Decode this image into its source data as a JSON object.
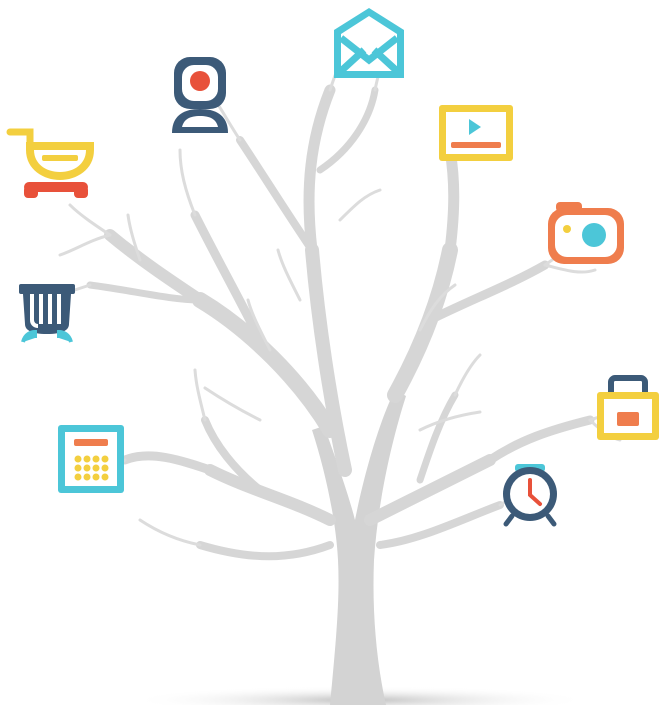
{
  "colors": {
    "background": "#ffffff",
    "tree": "#d6d6d6",
    "tree_dark": "#cfcfcf",
    "ground_shadow": "#bdbdbd",
    "navy": "#3c5a78",
    "red": "#e8513a",
    "orange": "#ef7d4d",
    "yellow": "#f3cf3f",
    "cyan": "#4cc6d8",
    "white": "#ffffff"
  },
  "icons": [
    {
      "name": "mail-envelope-icon"
    },
    {
      "name": "webcam-icon"
    },
    {
      "name": "video-player-icon"
    },
    {
      "name": "shopping-cart-icon"
    },
    {
      "name": "camera-icon"
    },
    {
      "name": "trash-bin-icon"
    },
    {
      "name": "briefcase-icon"
    },
    {
      "name": "calculator-icon"
    },
    {
      "name": "alarm-clock-icon"
    }
  ]
}
